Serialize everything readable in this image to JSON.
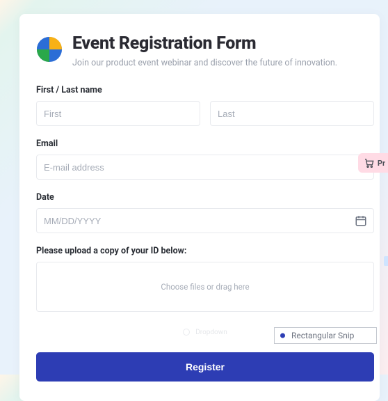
{
  "header": {
    "title": "Event Registration Form",
    "subtitle": "Join our product event webinar and discover the future of innovation."
  },
  "fields": {
    "name_label": "First / Last name",
    "first_placeholder": "First",
    "last_placeholder": "Last",
    "email_label": "Email",
    "email_placeholder": "E-mail address",
    "date_label": "Date",
    "date_placeholder": "MM/DD/YYYY",
    "upload_label": "Please upload a copy of your ID below:",
    "upload_hint": "Choose files or drag here",
    "dropdown_label": "Dropdown"
  },
  "actions": {
    "register": "Register"
  },
  "side": {
    "tag_text": "Pr"
  },
  "overlay": {
    "snip_label": "Rectangular Snip"
  }
}
